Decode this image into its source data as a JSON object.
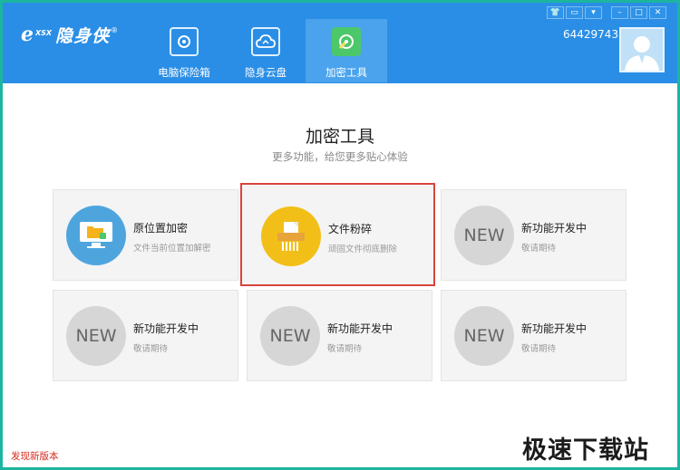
{
  "app": {
    "logo_small": "XSX",
    "logo_text": "隐身侠",
    "logo_reg": "®"
  },
  "nav": {
    "tabs": [
      {
        "label": "电脑保险箱",
        "icon": "safe-icon"
      },
      {
        "label": "隐身云盘",
        "icon": "cloud-icon"
      },
      {
        "label": "加密工具",
        "icon": "tools-icon",
        "active": true
      }
    ]
  },
  "window_controls": {
    "skin": "shirt-icon",
    "message": "message-icon",
    "menu": "menu-icon",
    "minimize": "minimize-icon",
    "maximize": "maximize-icon",
    "close": "close-icon"
  },
  "user": {
    "id": "64429743",
    "avatar": "user-avatar-icon"
  },
  "main": {
    "title": "加密工具",
    "subtitle": "更多功能，给您更多贴心体验",
    "cards": [
      {
        "title": "原位置加密",
        "desc": "文件当前位置加解密",
        "icon": "monitor-folder-icon"
      },
      {
        "title": "文件粉碎",
        "desc": "顽固文件彻底删除",
        "icon": "shredder-icon"
      },
      {
        "title": "新功能开发中",
        "desc": "敬请期待",
        "badge": "NEW"
      },
      {
        "title": "新功能开发中",
        "desc": "敬请期待",
        "badge": "NEW"
      },
      {
        "title": "新功能开发中",
        "desc": "敬请期待",
        "badge": "NEW"
      },
      {
        "title": "新功能开发中",
        "desc": "敬请期待",
        "badge": "NEW"
      }
    ]
  },
  "footer": {
    "update_link": "发现新版本"
  },
  "watermark": "极速下载站",
  "colors": {
    "header": "#2a8ee6",
    "active_tab": "#4aa3ec",
    "frame": "#1cb5a0",
    "selected_border": "#d9443b",
    "update_text": "#d42a1c"
  }
}
